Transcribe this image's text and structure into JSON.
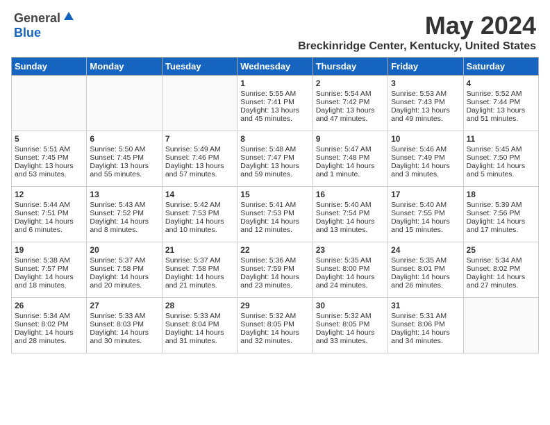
{
  "header": {
    "logo_general": "General",
    "logo_blue": "Blue",
    "month_title": "May 2024",
    "location": "Breckinridge Center, Kentucky, United States"
  },
  "weekdays": [
    "Sunday",
    "Monday",
    "Tuesday",
    "Wednesday",
    "Thursday",
    "Friday",
    "Saturday"
  ],
  "weeks": [
    [
      {
        "day": "",
        "data": ""
      },
      {
        "day": "",
        "data": ""
      },
      {
        "day": "",
        "data": ""
      },
      {
        "day": "1",
        "data": "Sunrise: 5:55 AM\nSunset: 7:41 PM\nDaylight: 13 hours\nand 45 minutes."
      },
      {
        "day": "2",
        "data": "Sunrise: 5:54 AM\nSunset: 7:42 PM\nDaylight: 13 hours\nand 47 minutes."
      },
      {
        "day": "3",
        "data": "Sunrise: 5:53 AM\nSunset: 7:43 PM\nDaylight: 13 hours\nand 49 minutes."
      },
      {
        "day": "4",
        "data": "Sunrise: 5:52 AM\nSunset: 7:44 PM\nDaylight: 13 hours\nand 51 minutes."
      }
    ],
    [
      {
        "day": "5",
        "data": "Sunrise: 5:51 AM\nSunset: 7:45 PM\nDaylight: 13 hours\nand 53 minutes."
      },
      {
        "day": "6",
        "data": "Sunrise: 5:50 AM\nSunset: 7:45 PM\nDaylight: 13 hours\nand 55 minutes."
      },
      {
        "day": "7",
        "data": "Sunrise: 5:49 AM\nSunset: 7:46 PM\nDaylight: 13 hours\nand 57 minutes."
      },
      {
        "day": "8",
        "data": "Sunrise: 5:48 AM\nSunset: 7:47 PM\nDaylight: 13 hours\nand 59 minutes."
      },
      {
        "day": "9",
        "data": "Sunrise: 5:47 AM\nSunset: 7:48 PM\nDaylight: 14 hours\nand 1 minute."
      },
      {
        "day": "10",
        "data": "Sunrise: 5:46 AM\nSunset: 7:49 PM\nDaylight: 14 hours\nand 3 minutes."
      },
      {
        "day": "11",
        "data": "Sunrise: 5:45 AM\nSunset: 7:50 PM\nDaylight: 14 hours\nand 5 minutes."
      }
    ],
    [
      {
        "day": "12",
        "data": "Sunrise: 5:44 AM\nSunset: 7:51 PM\nDaylight: 14 hours\nand 6 minutes."
      },
      {
        "day": "13",
        "data": "Sunrise: 5:43 AM\nSunset: 7:52 PM\nDaylight: 14 hours\nand 8 minutes."
      },
      {
        "day": "14",
        "data": "Sunrise: 5:42 AM\nSunset: 7:53 PM\nDaylight: 14 hours\nand 10 minutes."
      },
      {
        "day": "15",
        "data": "Sunrise: 5:41 AM\nSunset: 7:53 PM\nDaylight: 14 hours\nand 12 minutes."
      },
      {
        "day": "16",
        "data": "Sunrise: 5:40 AM\nSunset: 7:54 PM\nDaylight: 14 hours\nand 13 minutes."
      },
      {
        "day": "17",
        "data": "Sunrise: 5:40 AM\nSunset: 7:55 PM\nDaylight: 14 hours\nand 15 minutes."
      },
      {
        "day": "18",
        "data": "Sunrise: 5:39 AM\nSunset: 7:56 PM\nDaylight: 14 hours\nand 17 minutes."
      }
    ],
    [
      {
        "day": "19",
        "data": "Sunrise: 5:38 AM\nSunset: 7:57 PM\nDaylight: 14 hours\nand 18 minutes."
      },
      {
        "day": "20",
        "data": "Sunrise: 5:37 AM\nSunset: 7:58 PM\nDaylight: 14 hours\nand 20 minutes."
      },
      {
        "day": "21",
        "data": "Sunrise: 5:37 AM\nSunset: 7:58 PM\nDaylight: 14 hours\nand 21 minutes."
      },
      {
        "day": "22",
        "data": "Sunrise: 5:36 AM\nSunset: 7:59 PM\nDaylight: 14 hours\nand 23 minutes."
      },
      {
        "day": "23",
        "data": "Sunrise: 5:35 AM\nSunset: 8:00 PM\nDaylight: 14 hours\nand 24 minutes."
      },
      {
        "day": "24",
        "data": "Sunrise: 5:35 AM\nSunset: 8:01 PM\nDaylight: 14 hours\nand 26 minutes."
      },
      {
        "day": "25",
        "data": "Sunrise: 5:34 AM\nSunset: 8:02 PM\nDaylight: 14 hours\nand 27 minutes."
      }
    ],
    [
      {
        "day": "26",
        "data": "Sunrise: 5:34 AM\nSunset: 8:02 PM\nDaylight: 14 hours\nand 28 minutes."
      },
      {
        "day": "27",
        "data": "Sunrise: 5:33 AM\nSunset: 8:03 PM\nDaylight: 14 hours\nand 30 minutes."
      },
      {
        "day": "28",
        "data": "Sunrise: 5:33 AM\nSunset: 8:04 PM\nDaylight: 14 hours\nand 31 minutes."
      },
      {
        "day": "29",
        "data": "Sunrise: 5:32 AM\nSunset: 8:05 PM\nDaylight: 14 hours\nand 32 minutes."
      },
      {
        "day": "30",
        "data": "Sunrise: 5:32 AM\nSunset: 8:05 PM\nDaylight: 14 hours\nand 33 minutes."
      },
      {
        "day": "31",
        "data": "Sunrise: 5:31 AM\nSunset: 8:06 PM\nDaylight: 14 hours\nand 34 minutes."
      },
      {
        "day": "",
        "data": ""
      }
    ]
  ]
}
